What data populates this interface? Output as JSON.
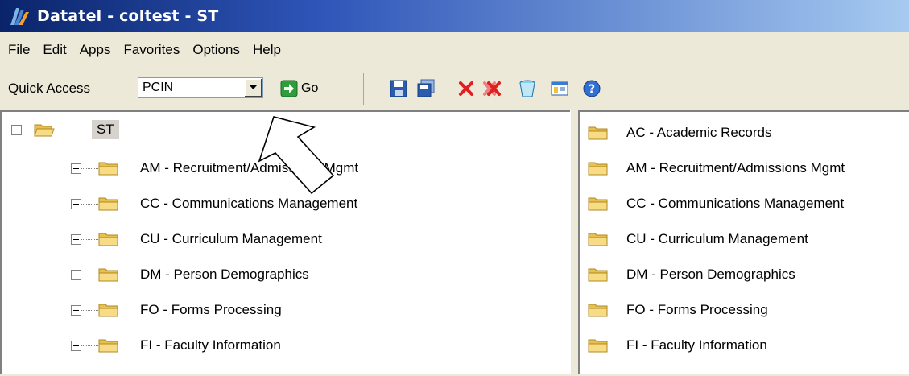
{
  "window": {
    "title": "Datatel - coltest - ST"
  },
  "menu": [
    "File",
    "Edit",
    "Apps",
    "Favorites",
    "Options",
    "Help"
  ],
  "toolbar": {
    "quick_access_label": "Quick Access",
    "quick_access_value": "PCIN",
    "go_label": "Go",
    "icons": [
      "save-icon",
      "save-copy-icon",
      "cancel-icon",
      "cancel-all-icon",
      "trash-icon",
      "window-icon",
      "help-icon"
    ]
  },
  "tree": {
    "root": "ST",
    "children": [
      "AM - Recruitment/Admissions Mgmt",
      "CC - Communications Management",
      "CU - Curriculum Management",
      "DM - Person Demographics",
      "FO - Forms Processing",
      "FI - Faculty Information"
    ]
  },
  "list": {
    "items": [
      "AC - Academic Records",
      "AM - Recruitment/Admissions Mgmt",
      "CC - Communications Management",
      "CU - Curriculum Management",
      "DM - Person Demographics",
      "FO - Forms Processing",
      "FI - Faculty Information"
    ]
  },
  "colors": {
    "title_bar_start": "#0a246a",
    "title_bar_end": "#a6caf0",
    "window_bg": "#ece9d8",
    "folder": "#f2d36b"
  }
}
